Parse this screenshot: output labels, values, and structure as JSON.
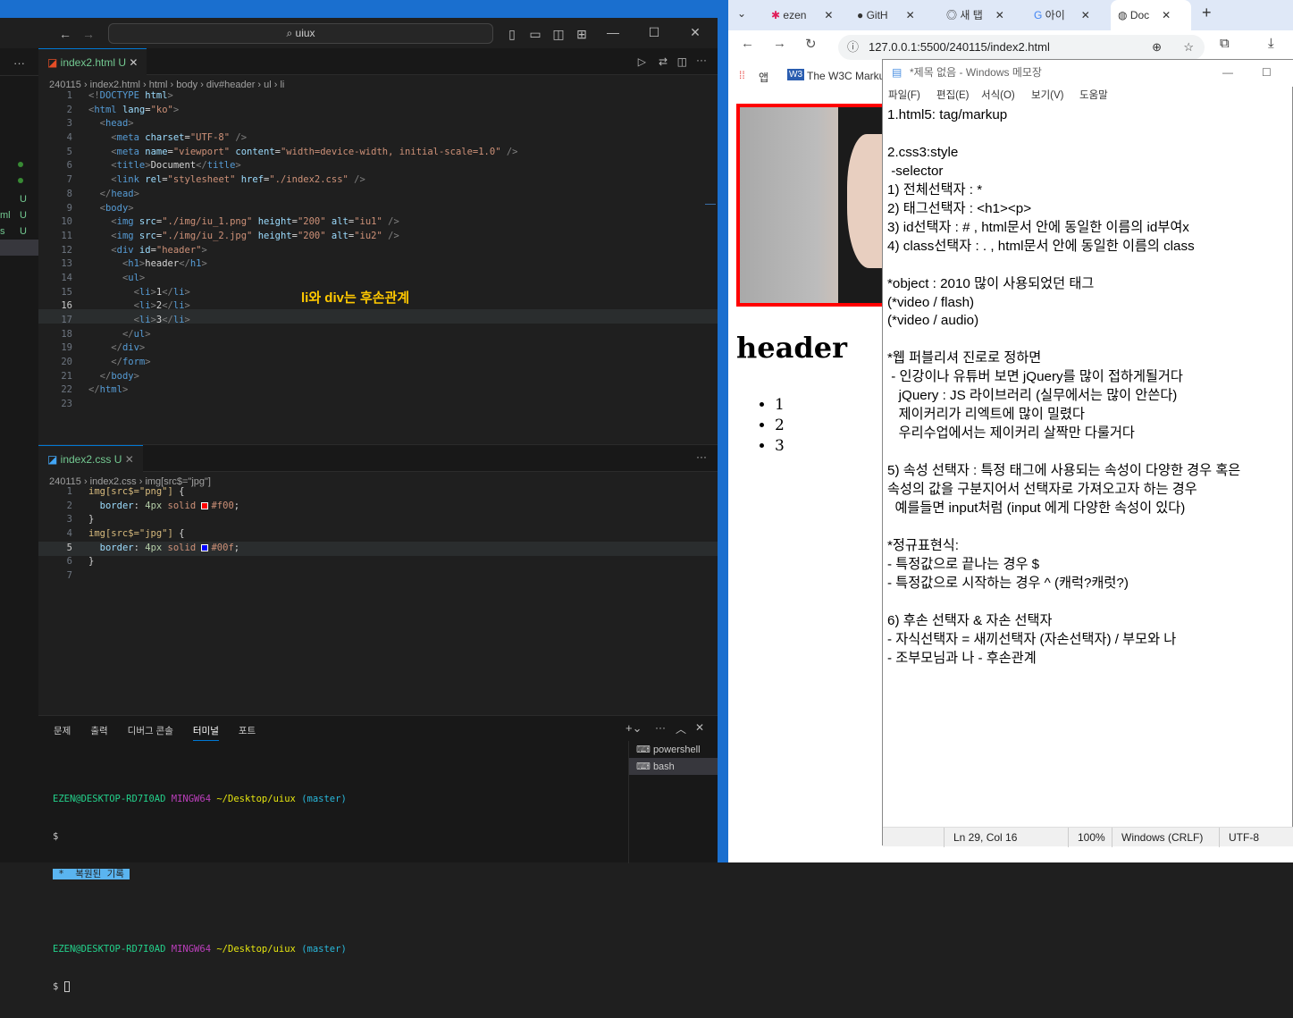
{
  "vscode": {
    "search": "uiux",
    "editor1": {
      "tab": "index2.html",
      "tab_badge": "U",
      "breadcrumb": [
        "240115",
        "index2.html",
        "html",
        "body",
        "div#header",
        "ul",
        "li"
      ],
      "lines": [
        [
          [
            "pu",
            "<!"
          ],
          [
            "tg",
            "DOCTYPE"
          ],
          [
            "at",
            " html"
          ],
          [
            "pu",
            ">"
          ]
        ],
        [
          [
            "pu",
            "<"
          ],
          [
            "tg",
            "html"
          ],
          [
            "at",
            " lang"
          ],
          [
            "tx",
            "="
          ],
          [
            "st",
            "\"ko\""
          ],
          [
            "pu",
            ">"
          ]
        ],
        [
          [
            "tx",
            "  "
          ],
          [
            "pu",
            "<"
          ],
          [
            "tg",
            "head"
          ],
          [
            "pu",
            ">"
          ]
        ],
        [
          [
            "tx",
            "    "
          ],
          [
            "pu",
            "<"
          ],
          [
            "tg",
            "meta"
          ],
          [
            "at",
            " charset"
          ],
          [
            "tx",
            "="
          ],
          [
            "st",
            "\"UTF-8\""
          ],
          [
            "pu",
            " />"
          ]
        ],
        [
          [
            "tx",
            "    "
          ],
          [
            "pu",
            "<"
          ],
          [
            "tg",
            "meta"
          ],
          [
            "at",
            " name"
          ],
          [
            "tx",
            "="
          ],
          [
            "st",
            "\"viewport\""
          ],
          [
            "at",
            " content"
          ],
          [
            "tx",
            "="
          ],
          [
            "st",
            "\"width=device-width, initial-scale=1.0\""
          ],
          [
            "pu",
            " />"
          ]
        ],
        [
          [
            "tx",
            "    "
          ],
          [
            "pu",
            "<"
          ],
          [
            "tg",
            "title"
          ],
          [
            "pu",
            ">"
          ],
          [
            "tx",
            "Document"
          ],
          [
            "pu",
            "</"
          ],
          [
            "tg",
            "title"
          ],
          [
            "pu",
            ">"
          ]
        ],
        [
          [
            "tx",
            "    "
          ],
          [
            "pu",
            "<"
          ],
          [
            "tg",
            "link"
          ],
          [
            "at",
            " rel"
          ],
          [
            "tx",
            "="
          ],
          [
            "st",
            "\"stylesheet\""
          ],
          [
            "at",
            " href"
          ],
          [
            "tx",
            "="
          ],
          [
            "st",
            "\"./index2.css\""
          ],
          [
            "pu",
            " />"
          ]
        ],
        [
          [
            "tx",
            "  "
          ],
          [
            "pu",
            "</"
          ],
          [
            "tg",
            "head"
          ],
          [
            "pu",
            ">"
          ]
        ],
        [
          [
            "tx",
            "  "
          ],
          [
            "pu",
            "<"
          ],
          [
            "tg",
            "body"
          ],
          [
            "pu",
            ">"
          ]
        ],
        [
          [
            "tx",
            "    "
          ],
          [
            "pu",
            "<"
          ],
          [
            "tg",
            "img"
          ],
          [
            "at",
            " src"
          ],
          [
            "tx",
            "="
          ],
          [
            "st",
            "\"./img/iu_1.png\""
          ],
          [
            "at",
            " height"
          ],
          [
            "tx",
            "="
          ],
          [
            "st",
            "\"200\""
          ],
          [
            "at",
            " alt"
          ],
          [
            "tx",
            "="
          ],
          [
            "st",
            "\"iu1\""
          ],
          [
            "pu",
            " />"
          ]
        ],
        [
          [
            "tx",
            "    "
          ],
          [
            "pu",
            "<"
          ],
          [
            "tg",
            "img"
          ],
          [
            "at",
            " src"
          ],
          [
            "tx",
            "="
          ],
          [
            "st",
            "\"./img/iu_2.jpg\""
          ],
          [
            "at",
            " height"
          ],
          [
            "tx",
            "="
          ],
          [
            "st",
            "\"200\""
          ],
          [
            "at",
            " alt"
          ],
          [
            "tx",
            "="
          ],
          [
            "st",
            "\"iu2\""
          ],
          [
            "pu",
            " />"
          ]
        ],
        [
          [
            "tx",
            "    "
          ],
          [
            "pu",
            "<"
          ],
          [
            "tg",
            "div"
          ],
          [
            "at",
            " id"
          ],
          [
            "tx",
            "="
          ],
          [
            "st",
            "\"header\""
          ],
          [
            "pu",
            ">"
          ]
        ],
        [
          [
            "tx",
            "      "
          ],
          [
            "pu",
            "<"
          ],
          [
            "tg",
            "h1"
          ],
          [
            "pu",
            ">"
          ],
          [
            "tx",
            "header"
          ],
          [
            "pu",
            "</"
          ],
          [
            "tg",
            "h1"
          ],
          [
            "pu",
            ">"
          ]
        ],
        [
          [
            "tx",
            "      "
          ],
          [
            "pu",
            "<"
          ],
          [
            "tg",
            "ul"
          ],
          [
            "pu",
            ">"
          ]
        ],
        [
          [
            "tx",
            "        "
          ],
          [
            "pu",
            "<"
          ],
          [
            "tg",
            "li"
          ],
          [
            "pu",
            ">"
          ],
          [
            "tx",
            "1"
          ],
          [
            "pu",
            "</"
          ],
          [
            "tg",
            "li"
          ],
          [
            "pu",
            ">"
          ]
        ],
        [
          [
            "tx",
            "        "
          ],
          [
            "pu",
            "<"
          ],
          [
            "tg",
            "li"
          ],
          [
            "pu",
            ">"
          ],
          [
            "tx",
            "2"
          ],
          [
            "pu",
            "</"
          ],
          [
            "tg",
            "li"
          ],
          [
            "pu",
            ">"
          ]
        ],
        [
          [
            "tx",
            "        "
          ],
          [
            "pu",
            "<"
          ],
          [
            "tg",
            "li"
          ],
          [
            "pu",
            ">"
          ],
          [
            "tx",
            "3"
          ],
          [
            "pu",
            "</"
          ],
          [
            "tg",
            "li"
          ],
          [
            "pu",
            ">"
          ]
        ],
        [
          [
            "tx",
            "      "
          ],
          [
            "pu",
            "</"
          ],
          [
            "tg",
            "ul"
          ],
          [
            "pu",
            ">"
          ]
        ],
        [
          [
            "tx",
            "    "
          ],
          [
            "pu",
            "</"
          ],
          [
            "tg",
            "div"
          ],
          [
            "pu",
            ">"
          ]
        ],
        [
          [
            "tx",
            "    "
          ],
          [
            "pu",
            "</"
          ],
          [
            "tg",
            "form"
          ],
          [
            "pu",
            ">"
          ]
        ],
        [
          [
            "tx",
            "  "
          ],
          [
            "pu",
            "</"
          ],
          [
            "tg",
            "body"
          ],
          [
            "pu",
            ">"
          ]
        ],
        [
          [
            "pu",
            "</"
          ],
          [
            "tg",
            "html"
          ],
          [
            "pu",
            ">"
          ]
        ],
        [
          [
            "tx",
            ""
          ]
        ]
      ],
      "annotation": "li와 div는 후손관계",
      "active_line": 16
    },
    "editor2": {
      "tab": "index2.css",
      "tab_badge": "U",
      "breadcrumb": [
        "240115",
        "index2.css",
        "img[src$=\"jpg\"]"
      ],
      "lines": [
        [
          [
            "css-sel",
            "img[src$=\"png\"]"
          ],
          [
            "tx",
            " {"
          ]
        ],
        [
          [
            "tx",
            "  "
          ],
          [
            "css-prop",
            "border"
          ],
          [
            "tx",
            ": "
          ],
          [
            "css-num",
            "4px"
          ],
          [
            "css-val",
            " solid "
          ],
          [
            "swatch",
            "#ff0000"
          ],
          [
            "css-val",
            "#f00"
          ],
          [
            "tx",
            ";"
          ]
        ],
        [
          [
            "tx",
            "}"
          ]
        ],
        [
          [
            "css-sel",
            "img[src$=\"jpg\"]"
          ],
          [
            "tx",
            " {"
          ]
        ],
        [
          [
            "tx",
            "  "
          ],
          [
            "css-prop",
            "border"
          ],
          [
            "tx",
            ": "
          ],
          [
            "css-num",
            "4px"
          ],
          [
            "css-val",
            " solid "
          ],
          [
            "swatch",
            "#0000ff"
          ],
          [
            "css-val",
            "#00f"
          ],
          [
            "tx",
            ";"
          ]
        ],
        [
          [
            "tx",
            "}"
          ]
        ],
        [
          [
            "tx",
            ""
          ]
        ]
      ],
      "active_line": 5
    },
    "sidebar_badges": [
      "U",
      "U",
      "U",
      "U"
    ],
    "sidebar_snips": [
      "ml",
      "s",
      "ml"
    ],
    "terminal": {
      "tabs": [
        "문제",
        "출력",
        "디버그 콘솔",
        "터미널",
        "포트"
      ],
      "active_tab": "터미널",
      "shells": [
        "powershell",
        "bash"
      ],
      "prompt_user": "EZEN@DESKTOP-RD7I0AD",
      "prompt_sys": "MINGW64",
      "prompt_path": "~/Desktop/uiux",
      "prompt_branch": "(master)",
      "restored": " *  복원된 기록 "
    }
  },
  "chrome": {
    "tabs": [
      "ezen",
      "GitH",
      "새 탭",
      "아이",
      "Doc"
    ],
    "url": "127.0.0.1:5500/240115/index2.html",
    "bookmarks": [
      "앱",
      "The W3C Marku"
    ],
    "page": {
      "heading": "header",
      "list": [
        "1",
        "2",
        "3"
      ],
      "img_border": "#ff0000"
    }
  },
  "notepad": {
    "title": "*제목 없음 - Windows 메모장",
    "menu": [
      "파일(F)",
      "편집(E)",
      "서식(O)",
      "보기(V)",
      "도움말"
    ],
    "text": "1.html5: tag/markup\n\n2.css3:style\n -selector\n1) 전체선택자 : *\n2) 태그선택자 : <h1><p>\n3) id선택자 : # , html문서 안에 동일한 이름의 id부여x\n4) class선택자 : . , html문서 안에 동일한 이름의 class\n\n*object : 2010 많이 사용되었던 태그\n(*video / flash)\n(*video / audio)\n\n*웹 퍼블리셔 진로로 정하면\n - 인강이나 유튜버 보면 jQuery를 많이 접하게될거다\n   jQuery : JS 라이브러리 (실무에서는 많이 안쓴다)\n   제이커리가 리엑트에 많이 밀렸다\n   우리수업에서는 제이커리 살짝만 다룰거다\n\n5) 속성 선택자 : 특정 태그에 사용되는 속성이 다양한 경우 혹은\n속성의 값을 구분지어서 선택자로 가져오고자 하는 경우\n  예를들면 input처럼 (input 에게 다양한 속성이 있다)\n\n*정규표현식:\n- 특정값으로 끝나는 경우 $\n- 특정값으로 시작하는 경우 ^ (캐럭?캐럿?)\n\n6) 후손 선택자 & 자손 선택자\n- 자식선택자 = 새끼선택자 (자손선택자) / 부모와 나\n- 조부모님과 나 - 후손관계",
    "status": {
      "pos": "Ln 29, Col 16",
      "zoom": "100%",
      "eol": "Windows (CRLF)",
      "enc": "UTF-8"
    }
  }
}
